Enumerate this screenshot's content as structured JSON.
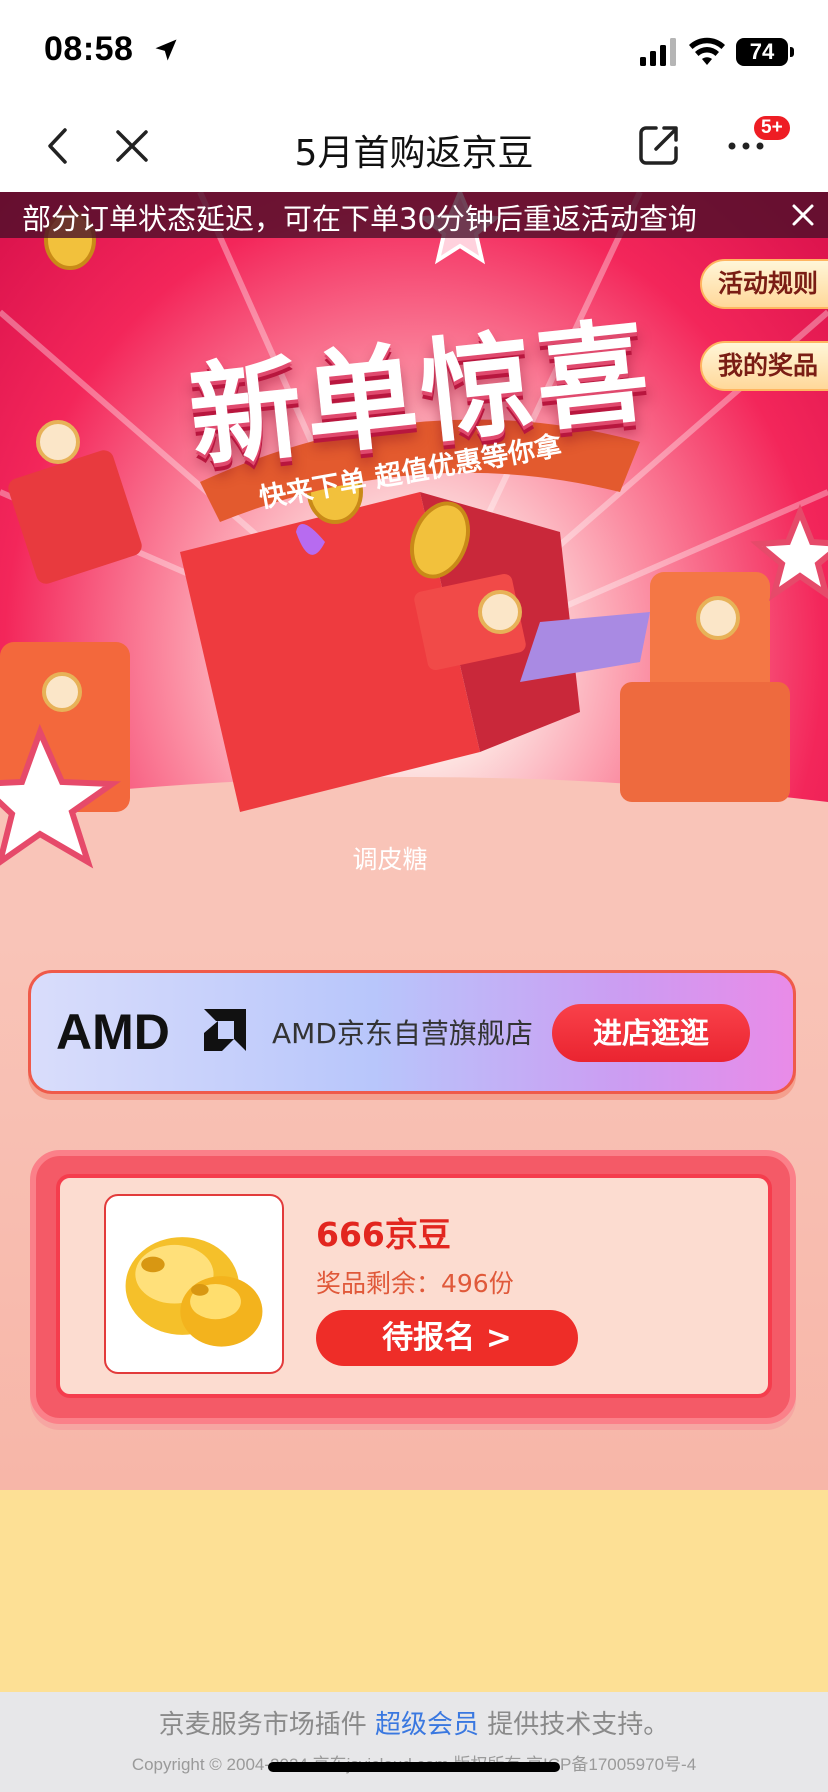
{
  "status_bar": {
    "time": "08:58",
    "battery": "74"
  },
  "nav": {
    "title": "5月首购返京豆",
    "badge": "5+"
  },
  "notice": {
    "text": "部分订单状态延迟，可在下单30分钟后重返活动查询"
  },
  "hero": {
    "title": "新单惊喜",
    "subtitle": "快来下单 超值优惠等你拿",
    "caption": "调皮糖",
    "side_buttons": {
      "rules": "活动规则",
      "prizes": "我的奖品"
    }
  },
  "store": {
    "logo_text": "AMD",
    "name": "AMD京东自营旗舰店",
    "button": "进店逛逛"
  },
  "prize": {
    "name": "666京豆",
    "remaining": "奖品剩余：496份",
    "button": "待报名 >"
  },
  "footer": {
    "prefix": "京麦服务市场插件 ",
    "link": "超级会员",
    "suffix": " 提供技术支持。",
    "copyright": "Copyright © 2004-2024 京东jsvicloud.com 版权所有 京ICP备17005970号-4"
  },
  "colors": {
    "accent_red": "#ee2d28",
    "brand_pink": "#f3265a",
    "footer_link": "#3a78e0",
    "bottom_bg": "#fde095"
  },
  "icons": [
    "location-arrow-icon",
    "signal-icon",
    "wifi-icon",
    "back-icon",
    "close-icon",
    "share-icon",
    "more-icon",
    "notice-close-icon",
    "amd-logo",
    "jd-bean-image"
  ]
}
